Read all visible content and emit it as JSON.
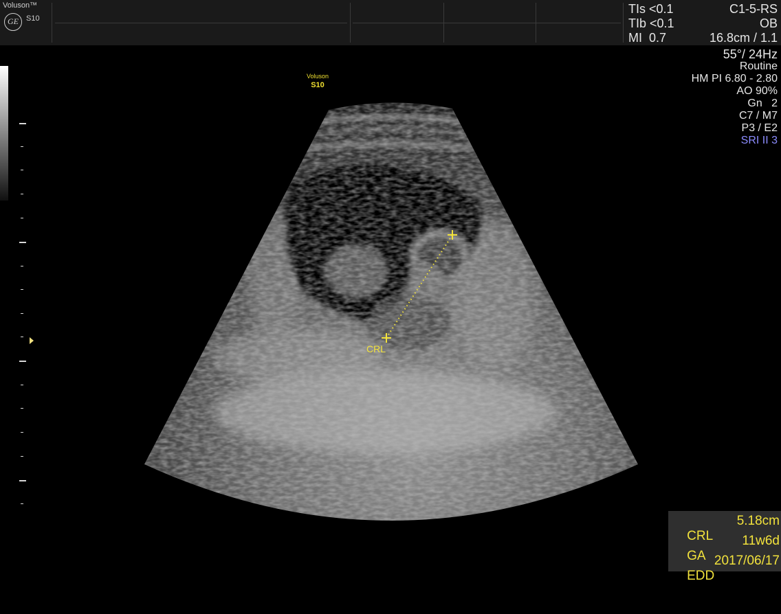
{
  "header": {
    "brand_name": "Voluson™",
    "brand_model": "S10",
    "logo_text": "GE",
    "safety": [
      "TIs <0.1",
      "TIb <0.1",
      "MI  0.7"
    ],
    "probe": [
      "C1-5-RS",
      "OB",
      "16.8cm / 1.1"
    ]
  },
  "params": [
    "55°/ 24Hz",
    "Routine",
    "HM PI 6.80 - 2.80",
    "AO 90%",
    "Gn   2",
    "C7 / M7",
    "P3 / E2",
    "SRI II 3"
  ],
  "watermark": {
    "line1": "Voluson",
    "line2": "S10"
  },
  "caliper_label": "CRL",
  "measurements": [
    {
      "label": "CRL",
      "value": "5.18cm"
    },
    {
      "label": "GA",
      "value": "11w6d"
    },
    {
      "label": "EDD",
      "value": "2017/06/17"
    }
  ],
  "colors": {
    "caliper": "#f2e23c",
    "sri": "#8c8cff",
    "topbar": "#1a1a1a",
    "meas_box": "#2f2f2f"
  },
  "icons": [
    "ge-logo",
    "caliper-cross-icon",
    "focus-marker-icon"
  ]
}
